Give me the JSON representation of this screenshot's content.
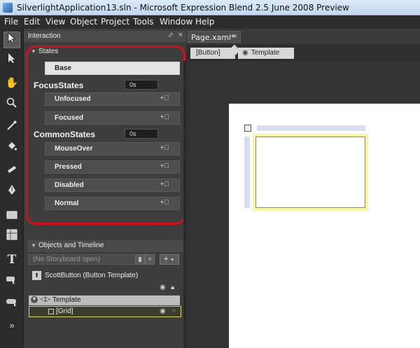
{
  "window": {
    "title": "SilverlightApplication13.sln - Microsoft Expression Blend 2.5 June 2008 Preview"
  },
  "menu": [
    "File",
    "Edit",
    "View",
    "Object",
    "Project",
    "Tools",
    "Window",
    "Help"
  ],
  "toolbox": {
    "tools": [
      "selection-tool",
      "direct-selection-tool",
      "pan-tool",
      "zoom-tool",
      "eyedropper-tool",
      "paint-bucket-tool",
      "brush-transform-tool",
      "pen-tool",
      "rectangle-tool",
      "grid-tool",
      "text-tool",
      "asset-tool",
      "control-tool",
      "more-tools"
    ]
  },
  "interaction_panel": {
    "title": "Interaction",
    "pin_icon": "pin-icon",
    "close_icon": "close-icon",
    "states": {
      "title": "States",
      "base_label": "Base",
      "groups": [
        {
          "name": "FocusStates",
          "transition_time": "0s",
          "states": [
            "Unfocused",
            "Focused"
          ]
        },
        {
          "name": "CommonStates",
          "transition_time": "0s",
          "states": [
            "MouseOver",
            "Pressed",
            "Disabled",
            "Normal"
          ]
        }
      ],
      "highlight_color": "#d0101a"
    },
    "objects": {
      "title": "Objects and Timeline",
      "storyboard_placeholder": "(No Storyboard open)",
      "add_button": "+",
      "scope_label": "ScottButton (Button Template)",
      "tree": [
        {
          "label": "Template"
        },
        {
          "label": "[Grid]"
        }
      ]
    }
  },
  "document": {
    "tab_label": "Page.xaml*",
    "breadcrumb": [
      "[Button]",
      "Template"
    ]
  }
}
